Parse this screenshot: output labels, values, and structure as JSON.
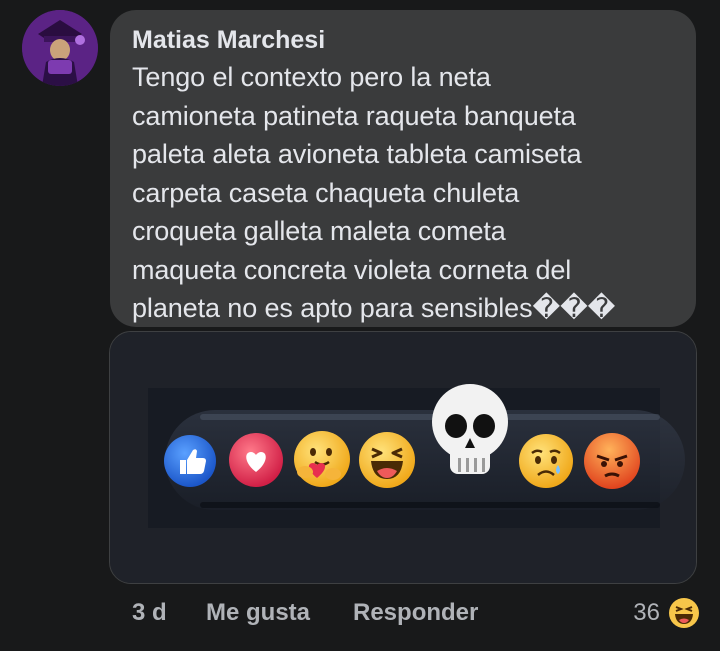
{
  "comment": {
    "author": "Matias Marchesi",
    "text": "Tengo el contexto pero la neta\ncamioneta patineta raqueta banqueta\npaleta aleta avioneta tableta camiseta\ncarpeta caseta chaqueta chuleta\ncroqueta galleta maleta cometa\nmaqueta concreta violeta corneta del\nplaneta no es apto para sensibles���"
  },
  "media": {
    "reactions": [
      "like-icon",
      "love-icon",
      "care-icon",
      "haha-icon",
      "skull-icon",
      "sad-icon",
      "angry-icon"
    ]
  },
  "footer": {
    "time": "3 d",
    "like_label": "Me gusta",
    "reply_label": "Responder",
    "reaction_count": "36",
    "reaction_icon": "haha-icon"
  },
  "colors": {
    "background": "#18191a",
    "bubble": "#3a3b3c",
    "text": "#e4e6eb",
    "muted": "#b0b3b8"
  }
}
